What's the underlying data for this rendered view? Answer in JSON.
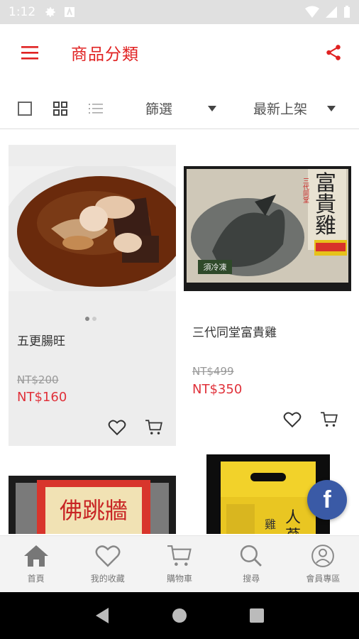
{
  "status_bar": {
    "time": "1:12"
  },
  "app_bar": {
    "title": "商品分類"
  },
  "toolbar": {
    "filter_label": "篩選",
    "sort_label": "最新上架"
  },
  "products": [
    {
      "name": "五更腸旺",
      "original_price": "NT$200",
      "price": "NT$160"
    },
    {
      "name": "三代同堂富貴雞",
      "original_price": "NT$499",
      "price": "NT$350"
    }
  ],
  "product_images": [
    {
      "texts": []
    },
    {
      "texts": [
        "富",
        "貴",
        "雞",
        "三代同堂",
        "須冷凍"
      ]
    },
    {
      "texts": [
        "佛跳牆"
      ]
    },
    {
      "texts": [
        "人",
        "蔘",
        "雞"
      ]
    }
  ],
  "facebook_button": {
    "label": "f"
  },
  "bottom_nav": [
    {
      "label": "首頁"
    },
    {
      "label": "我的收藏"
    },
    {
      "label": "購物車"
    },
    {
      "label": "搜尋"
    },
    {
      "label": "會員專區"
    }
  ],
  "colors": {
    "accent": "#e02222",
    "price": "#e0313a",
    "facebook": "#3a5aa6"
  }
}
